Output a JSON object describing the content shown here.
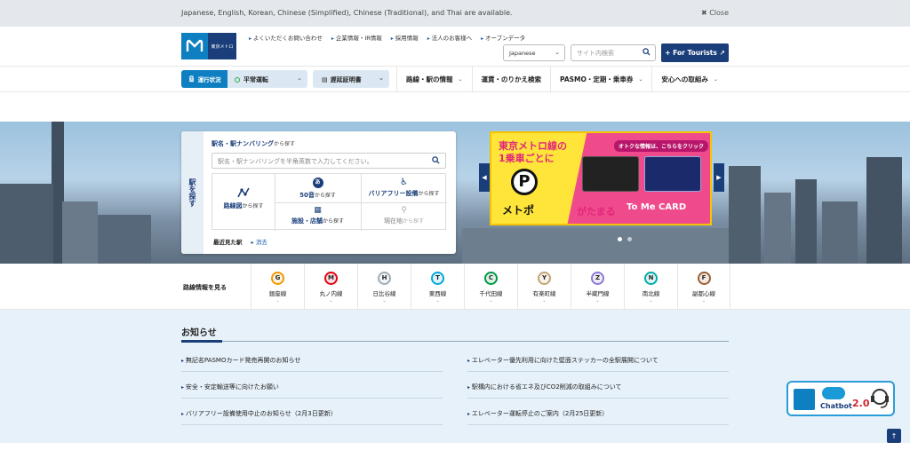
{
  "lang_bar": {
    "message": "Japanese, English, Korean, Chinese (Simplified), Chinese (Traditional), and Thai are available.",
    "close_label": "✖ Close"
  },
  "header": {
    "logo_text": "東京メトロ",
    "util_links": [
      "よくいただくお問い合わせ",
      "企業情報・IR情報",
      "採用情報",
      "法人のお客様へ",
      "オープンデータ"
    ],
    "language_selected": "Japanese",
    "site_search_placeholder": "サイト内検索",
    "tourist_button": "+ For Tourists ↗"
  },
  "nav": {
    "status_label": "運行状況",
    "status_value": "平常運転",
    "delay_cert_label": "遅延証明書",
    "items": [
      "路線・駅の情報",
      "運賃・のりかえ検索",
      "PASMO・定期・乗車券",
      "安心への取組み"
    ]
  },
  "station_search": {
    "tab_label": "駅を探す",
    "title": "駅名・駅ナンバリング",
    "title_suffix": "から探す",
    "input_placeholder": "駅名・駅ナンバリングを半角英数で入力してください。",
    "route_map": {
      "label": "路線図",
      "suffix": "から探す"
    },
    "kana_50": {
      "label": "50音",
      "suffix": "から探す",
      "icon_char": "あ"
    },
    "barrier_free": {
      "label": "バリアフリー設備",
      "suffix": "から探す"
    },
    "facilities": {
      "label": "施設・店舗",
      "suffix": "から探す"
    },
    "current_location": {
      "label": "現在地",
      "suffix": "から探す"
    },
    "recent_label": "最近見た駅",
    "recent_clear": "▸ 消去"
  },
  "banner": {
    "headline_line1": "東京メトロ線の",
    "headline_line2": "1乗車ごとに",
    "p_char": "P",
    "metopo": "メトポ",
    "gatamaru": "がたまる",
    "offer": "オトクな情報は、こちらをクリック",
    "card_name": "To Me CARD",
    "prev_icon": "◀",
    "next_icon": "▶"
  },
  "lines": {
    "label": "路線情報を見る",
    "items": [
      {
        "code": "G",
        "name": "銀座線",
        "color": "#f39700"
      },
      {
        "code": "M",
        "name": "丸ノ内線",
        "color": "#e60012"
      },
      {
        "code": "H",
        "name": "日比谷線",
        "color": "#9caeb7"
      },
      {
        "code": "T",
        "name": "東西線",
        "color": "#00a7db"
      },
      {
        "code": "C",
        "name": "千代田線",
        "color": "#009944"
      },
      {
        "code": "Y",
        "name": "有楽町線",
        "color": "#c1a470"
      },
      {
        "code": "Z",
        "name": "半蔵門線",
        "color": "#8f76d6"
      },
      {
        "code": "N",
        "name": "南北線",
        "color": "#00ada9"
      },
      {
        "code": "F",
        "name": "副都心線",
        "color": "#9c5e31"
      }
    ],
    "chevron": "⌄"
  },
  "notices": {
    "title": "お知らせ",
    "left": [
      "無記名PASMOカード発売再開のお知らせ",
      "安全・安定輸送等に向けたお願い",
      "バリアフリー設備使用中止のお知らせ（2月3日更新）"
    ],
    "right": [
      "エレベーター優先利用に向けた壁面ステッカーの全駅展開について",
      "駅構内における省エネ及びCO2削減の取組みについて",
      "エレベーター運転停止のご案内（2月25日更新）"
    ]
  },
  "chatbot": {
    "label": "Chatbot",
    "version": "2.0"
  },
  "to_top": "↑"
}
